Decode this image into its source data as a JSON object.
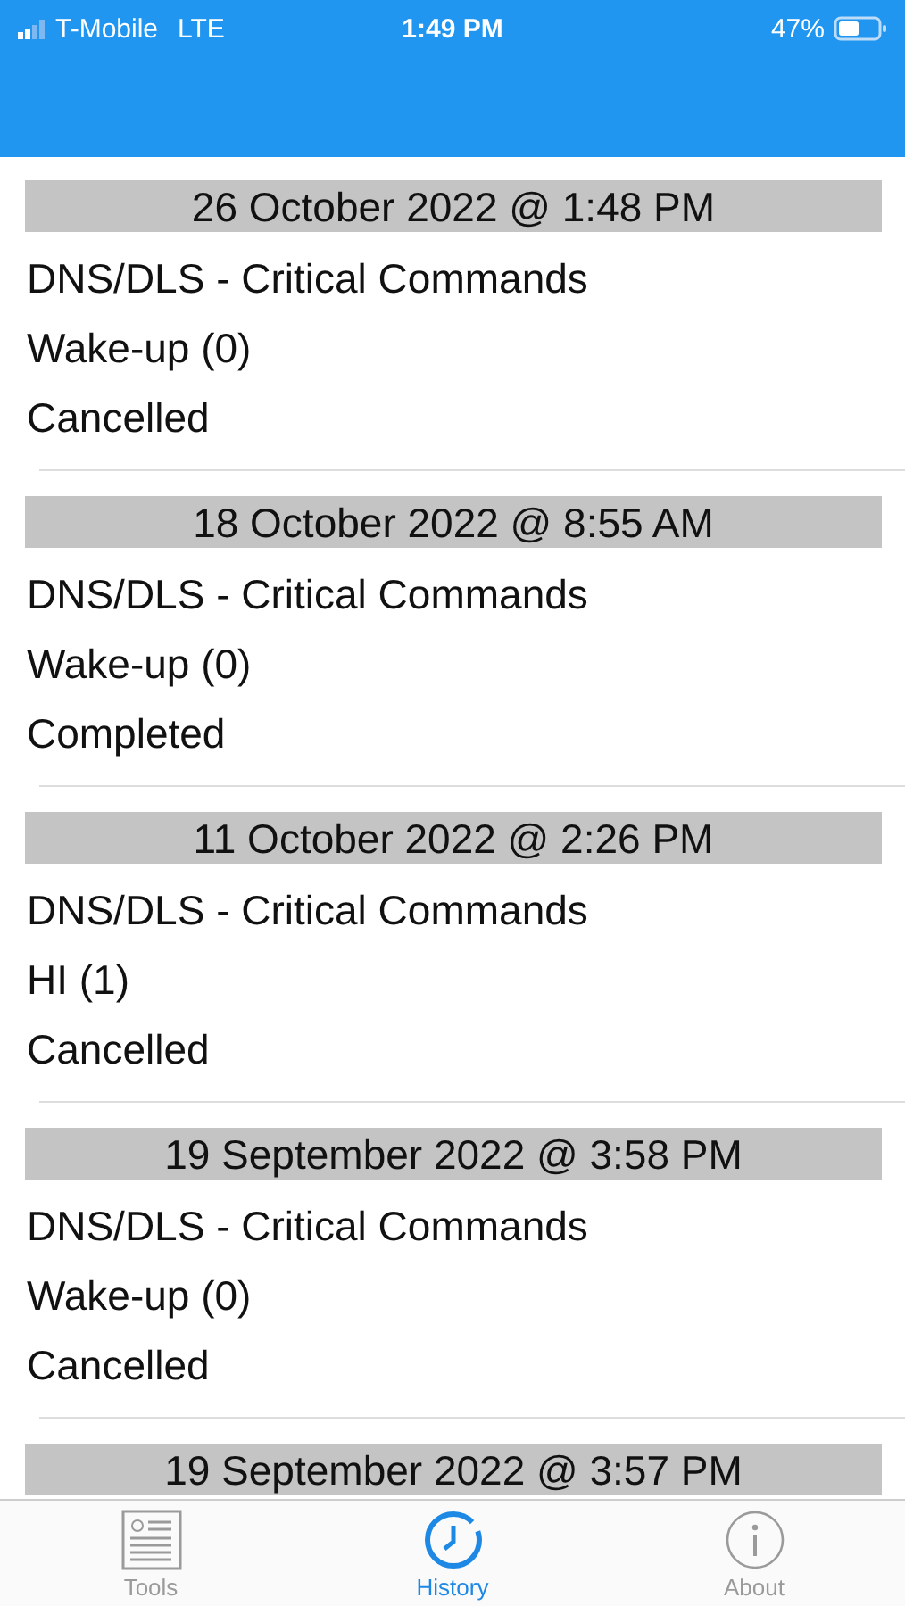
{
  "status_bar": {
    "carrier": "T-Mobile",
    "network": "LTE",
    "time": "1:49 PM",
    "battery": "47%"
  },
  "history": [
    {
      "date": "26 October 2022 @ 1:48 PM",
      "command_set": "DNS/DLS - Critical Commands",
      "command": "Wake-up (0)",
      "status": "Cancelled"
    },
    {
      "date": "18 October 2022 @ 8:55 AM",
      "command_set": "DNS/DLS - Critical Commands",
      "command": "Wake-up (0)",
      "status": "Completed"
    },
    {
      "date": "11 October 2022 @ 2:26 PM",
      "command_set": "DNS/DLS - Critical Commands",
      "command": "HI (1)",
      "status": "Cancelled"
    },
    {
      "date": "19 September 2022 @ 3:58 PM",
      "command_set": "DNS/DLS - Critical Commands",
      "command": "Wake-up (0)",
      "status": "Cancelled"
    },
    {
      "date": "19 September 2022 @ 3:57 PM"
    }
  ],
  "tabs": [
    {
      "label": "Tools",
      "kind": "tools",
      "selected": false
    },
    {
      "label": "History",
      "kind": "history",
      "selected": true
    },
    {
      "label": "About",
      "kind": "about",
      "selected": false
    }
  ]
}
